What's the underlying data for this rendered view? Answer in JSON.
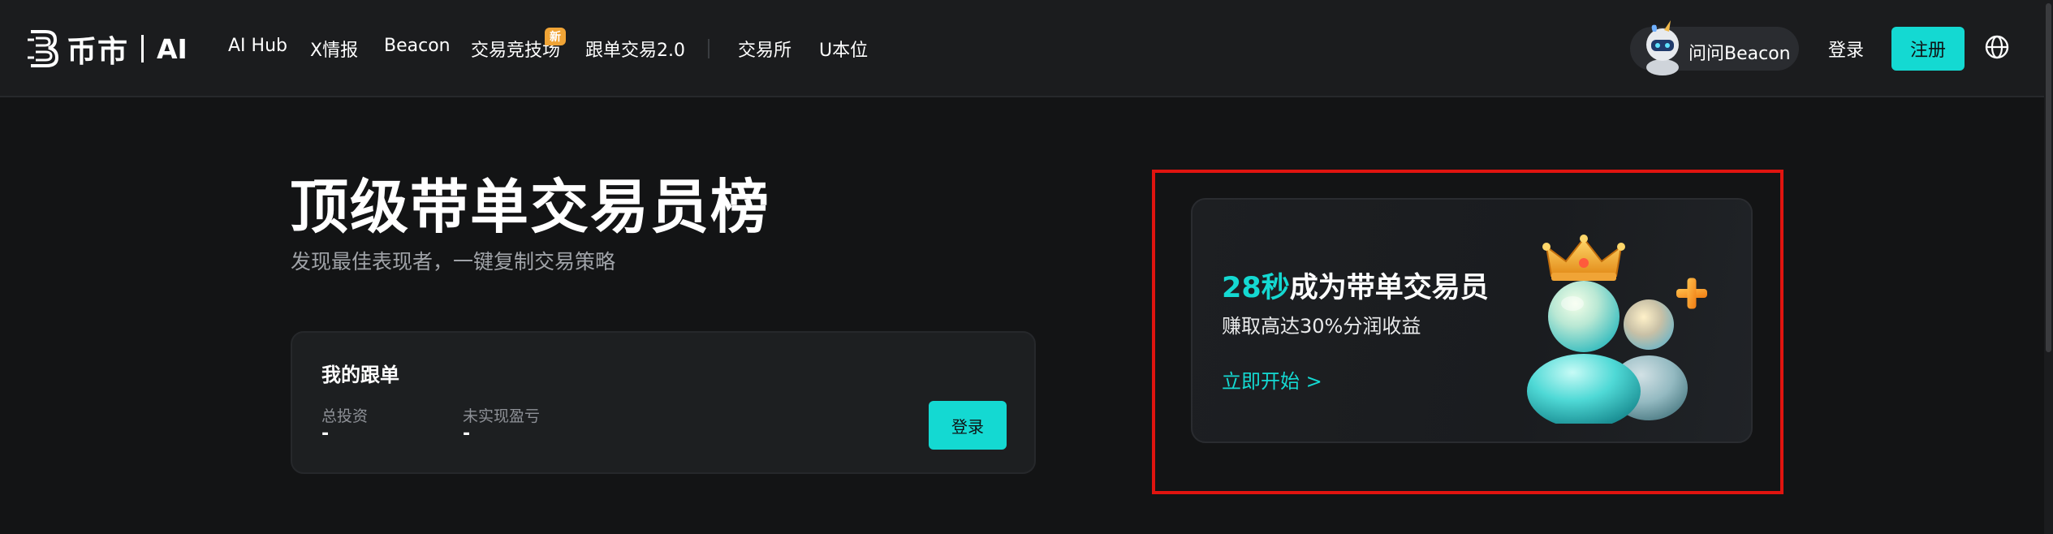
{
  "nav": {
    "logo_text": "币市",
    "logo_ai": "AI",
    "links": [
      "AI Hub",
      "X情报",
      "Beacon",
      "交易竞技场",
      "跟单交易2.0",
      "交易所",
      "U本位"
    ],
    "new_badge": "新",
    "ask_label": "问问Beacon",
    "login": "登录",
    "signup": "注册",
    "icons": {
      "logo": "logo-b-icon",
      "avatar": "beacon-avatar-icon",
      "language": "globe-icon"
    }
  },
  "hero": {
    "title": "顶级带单交易员榜",
    "subtitle": "发现最佳表现者，一键复制交易策略"
  },
  "follow_card": {
    "title": "我的跟单",
    "stats": [
      {
        "label": "总投资",
        "value": "-"
      },
      {
        "label": "未实现盈亏",
        "value": "-"
      }
    ],
    "login_button": "登录"
  },
  "promo": {
    "headline_accent": "28秒",
    "headline_rest": "成为带单交易员",
    "subtitle": "赚取高达30%分润收益",
    "cta": "立即开始 >",
    "art_icon": "trader-crown-illustration"
  },
  "colors": {
    "accent": "#14d9d2",
    "badge": "#f0a436",
    "highlight": "#e0140f",
    "background": "#131415"
  }
}
